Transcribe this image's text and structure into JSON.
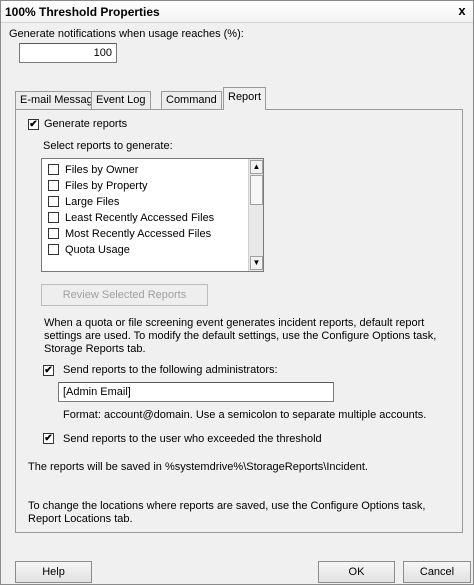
{
  "window": {
    "title": "100% Threshold Properties",
    "close_glyph": "x"
  },
  "threshold": {
    "label": "Generate notifications when usage reaches (%):",
    "value": "100"
  },
  "tabs": [
    {
      "label": "E-mail Message"
    },
    {
      "label": "Event Log"
    },
    {
      "label": "Command"
    },
    {
      "label": "Report"
    }
  ],
  "report": {
    "generate_label": "Generate reports",
    "select_label": "Select reports to generate:",
    "reports": [
      {
        "label": "Files by Owner"
      },
      {
        "label": "Files by Property"
      },
      {
        "label": "Large Files"
      },
      {
        "label": "Least Recently Accessed Files"
      },
      {
        "label": "Most Recently Accessed Files"
      },
      {
        "label": "Quota Usage"
      }
    ],
    "review_button": "Review Selected Reports",
    "info_text": "When a quota or file screening event generates incident reports, default report settings are used. To modify the default settings, use the Configure Options task, Storage Reports tab.",
    "send_admins_label": "Send reports to the following administrators:",
    "admin_email_value": "[Admin Email]",
    "format_text": "Format: account@domain. Use a semicolon to separate multiple accounts.",
    "send_user_label": "Send reports to the user who exceeded the threshold"
  },
  "saved_text": "The reports will be saved in %systemdrive%\\StorageReports\\Incident.",
  "change_text": "To change the locations where reports are saved, use the Configure Options task, Report Locations tab.",
  "buttons": {
    "help": "Help",
    "ok": "OK",
    "cancel": "Cancel"
  },
  "scroll_icons": {
    "up": "▲",
    "down": "▼"
  },
  "check_glyph": "✔"
}
